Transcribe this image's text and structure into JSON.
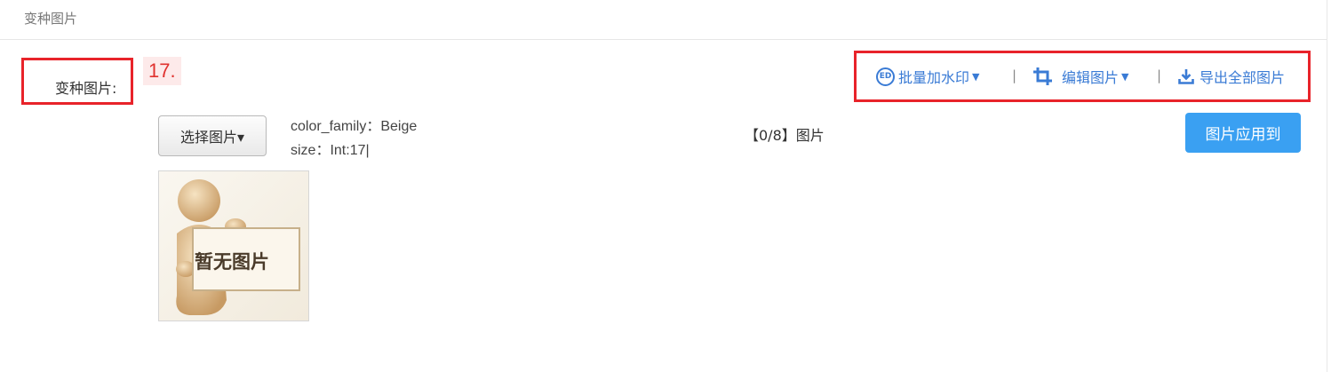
{
  "header": {
    "title": "变种图片"
  },
  "form": {
    "field_label": "变种图片:",
    "annotation_number": "17."
  },
  "toolbar": {
    "watermark": {
      "icon": "ed-circle-icon",
      "text": "ED",
      "label": "批量加水印"
    },
    "separator": "|",
    "edit": {
      "icon": "crop-icon",
      "label": "编辑图片"
    },
    "export": {
      "icon": "download-icon",
      "label": "导出全部图片"
    }
  },
  "variant": {
    "select_button": "选择图片▾",
    "attr_line1": "color_family：Beige",
    "attr_line2": "size：Int:17|",
    "count": "【0/8】图片",
    "apply_button": "图片应用到",
    "placeholder_text": "暂无图片"
  },
  "colors": {
    "accent": "#3a7bd5",
    "apply_button_bg": "#3aa0f2",
    "highlight_border": "#e8232a"
  }
}
